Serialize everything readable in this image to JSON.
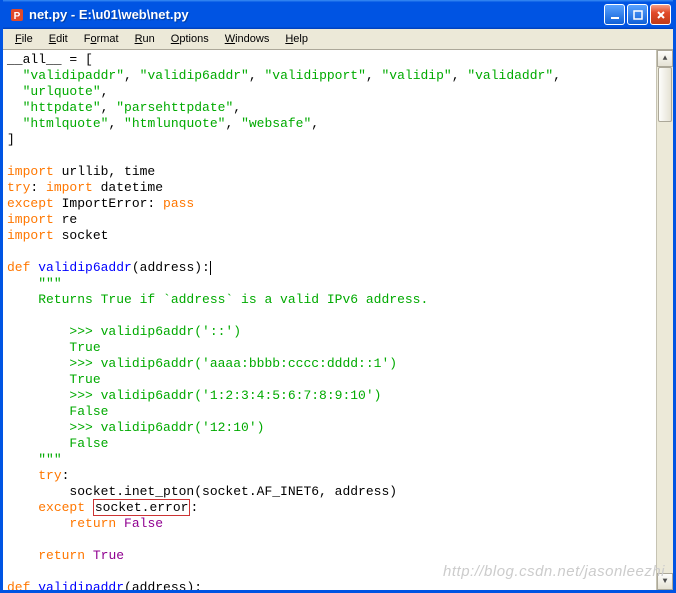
{
  "window": {
    "title": "net.py - E:\\u01\\web\\net.py"
  },
  "menu": {
    "items": [
      {
        "label": "File",
        "accel": "F"
      },
      {
        "label": "Edit",
        "accel": "E"
      },
      {
        "label": "Format",
        "accel": "o"
      },
      {
        "label": "Run",
        "accel": "R"
      },
      {
        "label": "Options",
        "accel": "O"
      },
      {
        "label": "Windows",
        "accel": "W"
      },
      {
        "label": "Help",
        "accel": "H"
      }
    ]
  },
  "code": {
    "lines": [
      {
        "t": [
          {
            "c": "n",
            "v": "__all__ = ["
          }
        ]
      },
      {
        "t": [
          {
            "c": "n",
            "v": "  "
          },
          {
            "c": "s",
            "v": "\"validipaddr\""
          },
          {
            "c": "n",
            "v": ", "
          },
          {
            "c": "s",
            "v": "\"validip6addr\""
          },
          {
            "c": "n",
            "v": ", "
          },
          {
            "c": "s",
            "v": "\"validipport\""
          },
          {
            "c": "n",
            "v": ", "
          },
          {
            "c": "s",
            "v": "\"validip\""
          },
          {
            "c": "n",
            "v": ", "
          },
          {
            "c": "s",
            "v": "\"validaddr\""
          },
          {
            "c": "n",
            "v": ","
          }
        ]
      },
      {
        "t": [
          {
            "c": "n",
            "v": "  "
          },
          {
            "c": "s",
            "v": "\"urlquote\""
          },
          {
            "c": "n",
            "v": ","
          }
        ]
      },
      {
        "t": [
          {
            "c": "n",
            "v": "  "
          },
          {
            "c": "s",
            "v": "\"httpdate\""
          },
          {
            "c": "n",
            "v": ", "
          },
          {
            "c": "s",
            "v": "\"parsehttpdate\""
          },
          {
            "c": "n",
            "v": ","
          }
        ]
      },
      {
        "t": [
          {
            "c": "n",
            "v": "  "
          },
          {
            "c": "s",
            "v": "\"htmlquote\""
          },
          {
            "c": "n",
            "v": ", "
          },
          {
            "c": "s",
            "v": "\"htmlunquote\""
          },
          {
            "c": "n",
            "v": ", "
          },
          {
            "c": "s",
            "v": "\"websafe\""
          },
          {
            "c": "n",
            "v": ","
          }
        ]
      },
      {
        "t": [
          {
            "c": "n",
            "v": "]"
          }
        ]
      },
      {
        "t": [
          {
            "c": "n",
            "v": ""
          }
        ]
      },
      {
        "t": [
          {
            "c": "k",
            "v": "import"
          },
          {
            "c": "n",
            "v": " urllib, time"
          }
        ]
      },
      {
        "t": [
          {
            "c": "k",
            "v": "try"
          },
          {
            "c": "n",
            "v": ": "
          },
          {
            "c": "k",
            "v": "import"
          },
          {
            "c": "n",
            "v": " datetime"
          }
        ]
      },
      {
        "t": [
          {
            "c": "k",
            "v": "except"
          },
          {
            "c": "n",
            "v": " ImportError: "
          },
          {
            "c": "k",
            "v": "pass"
          }
        ]
      },
      {
        "t": [
          {
            "c": "k",
            "v": "import"
          },
          {
            "c": "n",
            "v": " re"
          }
        ]
      },
      {
        "t": [
          {
            "c": "k",
            "v": "import"
          },
          {
            "c": "n",
            "v": " socket"
          }
        ]
      },
      {
        "t": [
          {
            "c": "n",
            "v": ""
          }
        ]
      },
      {
        "t": [
          {
            "c": "k",
            "v": "def"
          },
          {
            "c": "n",
            "v": " "
          },
          {
            "c": "b",
            "v": "validip6addr"
          },
          {
            "c": "n",
            "v": "(address):"
          },
          {
            "c": "cursor",
            "v": ""
          }
        ]
      },
      {
        "t": [
          {
            "c": "n",
            "v": "    "
          },
          {
            "c": "s",
            "v": "\"\"\""
          }
        ]
      },
      {
        "t": [
          {
            "c": "s",
            "v": "    Returns True if `address` is a valid IPv6 address."
          }
        ]
      },
      {
        "t": [
          {
            "c": "s",
            "v": ""
          }
        ]
      },
      {
        "t": [
          {
            "c": "s",
            "v": "        >>> validip6addr('::')"
          }
        ]
      },
      {
        "t": [
          {
            "c": "s",
            "v": "        True"
          }
        ]
      },
      {
        "t": [
          {
            "c": "s",
            "v": "        >>> validip6addr('aaaa:bbbb:cccc:dddd::1')"
          }
        ]
      },
      {
        "t": [
          {
            "c": "s",
            "v": "        True"
          }
        ]
      },
      {
        "t": [
          {
            "c": "s",
            "v": "        >>> validip6addr('1:2:3:4:5:6:7:8:9:10')"
          }
        ]
      },
      {
        "t": [
          {
            "c": "s",
            "v": "        False"
          }
        ]
      },
      {
        "t": [
          {
            "c": "s",
            "v": "        >>> validip6addr('12:10')"
          }
        ]
      },
      {
        "t": [
          {
            "c": "s",
            "v": "        False"
          }
        ]
      },
      {
        "t": [
          {
            "c": "n",
            "v": "    "
          },
          {
            "c": "s",
            "v": "\"\"\""
          }
        ]
      },
      {
        "t": [
          {
            "c": "n",
            "v": "    "
          },
          {
            "c": "k",
            "v": "try"
          },
          {
            "c": "n",
            "v": ":"
          }
        ]
      },
      {
        "t": [
          {
            "c": "n",
            "v": "        socket.inet_pton(socket.AF_INET6, address)"
          }
        ]
      },
      {
        "t": [
          {
            "c": "n",
            "v": "    "
          },
          {
            "c": "k",
            "v": "except"
          },
          {
            "c": "n",
            "v": " "
          },
          {
            "c": "box",
            "v": "socket.error"
          },
          {
            "c": "n",
            "v": ":"
          }
        ]
      },
      {
        "t": [
          {
            "c": "n",
            "v": "        "
          },
          {
            "c": "k",
            "v": "return"
          },
          {
            "c": "n",
            "v": " "
          },
          {
            "c": "d",
            "v": "False"
          }
        ]
      },
      {
        "t": [
          {
            "c": "n",
            "v": ""
          }
        ]
      },
      {
        "t": [
          {
            "c": "n",
            "v": "    "
          },
          {
            "c": "k",
            "v": "return"
          },
          {
            "c": "n",
            "v": " "
          },
          {
            "c": "d",
            "v": "True"
          }
        ]
      },
      {
        "t": [
          {
            "c": "n",
            "v": ""
          }
        ]
      },
      {
        "t": [
          {
            "c": "k",
            "v": "def"
          },
          {
            "c": "n",
            "v": " "
          },
          {
            "c": "b",
            "v": "validipaddr"
          },
          {
            "c": "n",
            "v": "(address):"
          }
        ]
      }
    ]
  },
  "watermark": "http://blog.csdn.net/jasonleezhi"
}
